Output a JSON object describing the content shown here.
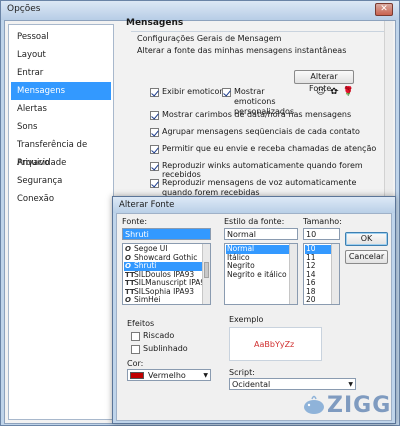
{
  "window": {
    "title": "Opções",
    "close_glyph": "✕"
  },
  "sidebar": {
    "items": [
      {
        "label": "Pessoal",
        "selected": false
      },
      {
        "label": "Layout",
        "selected": false
      },
      {
        "label": "Entrar",
        "selected": false
      },
      {
        "label": "Mensagens",
        "selected": true
      },
      {
        "label": "Alertas",
        "selected": false
      },
      {
        "label": "Sons",
        "selected": false
      },
      {
        "label": "Transferência de Arquivo",
        "selected": false
      },
      {
        "label": "Privacidade",
        "selected": false
      },
      {
        "label": "Segurança",
        "selected": false
      },
      {
        "label": "Conexão",
        "selected": false
      }
    ]
  },
  "messages": {
    "heading": "Mensagens",
    "group_title": "Configurações Gerais de Mensagem",
    "description": "Alterar a fonte das minhas mensagens instantâneas",
    "change_font_button": "Alterar Fonte...",
    "emoticon_preview": "😉 ✿ 🌹",
    "options": [
      {
        "label": "Exibir emoticons",
        "checked": true
      },
      {
        "label": "Mostrar emoticons personalizados",
        "checked": true
      },
      {
        "label": "Mostrar carimbos de data/hora nas mensagens",
        "checked": true
      },
      {
        "label": "Agrupar mensagens seqüenciais de cada contato",
        "checked": true
      },
      {
        "label": "Permitir que eu envie e receba chamadas de atenção",
        "checked": true
      },
      {
        "label": "Reproduzir winks automaticamente quando forem recebidos",
        "checked": true
      },
      {
        "label": "Reproduzir mensagens de voz automaticamente quando forem recebidas",
        "checked": true
      }
    ]
  },
  "font_dialog": {
    "title": "Alterar Fonte",
    "font_label": "Fonte:",
    "font_value": "Shruti",
    "font_list": [
      {
        "name": "Segoe UI",
        "type": "O",
        "selected": false
      },
      {
        "name": "Showcard Gothic",
        "type": "O",
        "selected": false
      },
      {
        "name": "Shruti",
        "type": "O",
        "selected": true
      },
      {
        "name": "SILDoulos IPA93",
        "type": "TT",
        "selected": false
      },
      {
        "name": "SILManuscript IPA93",
        "type": "TT",
        "selected": false
      },
      {
        "name": "SILSophia IPA93",
        "type": "TT",
        "selected": false
      },
      {
        "name": "SimHei",
        "type": "O",
        "selected": false
      }
    ],
    "style_label": "Estilo da fonte:",
    "style_value": "Normal",
    "style_list": [
      {
        "name": "Normal",
        "selected": true
      },
      {
        "name": "Itálico",
        "selected": false
      },
      {
        "name": "Negrito",
        "selected": false
      },
      {
        "name": "Negrito e itálico",
        "selected": false
      }
    ],
    "size_label": "Tamanho:",
    "size_value": "10",
    "size_list": [
      {
        "name": "10",
        "selected": true
      },
      {
        "name": "11",
        "selected": false
      },
      {
        "name": "12",
        "selected": false
      },
      {
        "name": "14",
        "selected": false
      },
      {
        "name": "16",
        "selected": false
      },
      {
        "name": "18",
        "selected": false
      },
      {
        "name": "20",
        "selected": false
      }
    ],
    "ok_button": "OK",
    "cancel_button": "Cancelar",
    "effects_label": "Efeitos",
    "strike_label": "Riscado",
    "strike_checked": false,
    "underline_label": "Sublinhado",
    "underline_checked": false,
    "color_label": "Cor:",
    "color_value": "Vermelho",
    "color_swatch": "#c00000",
    "sample_label": "Exemplo",
    "sample_text": "AaBbYyZz",
    "sample_color": "#d03030",
    "script_label": "Script:",
    "script_value": "Ocidental"
  },
  "watermark": {
    "text": "ZIGG",
    "color": "#7f9bc0"
  }
}
